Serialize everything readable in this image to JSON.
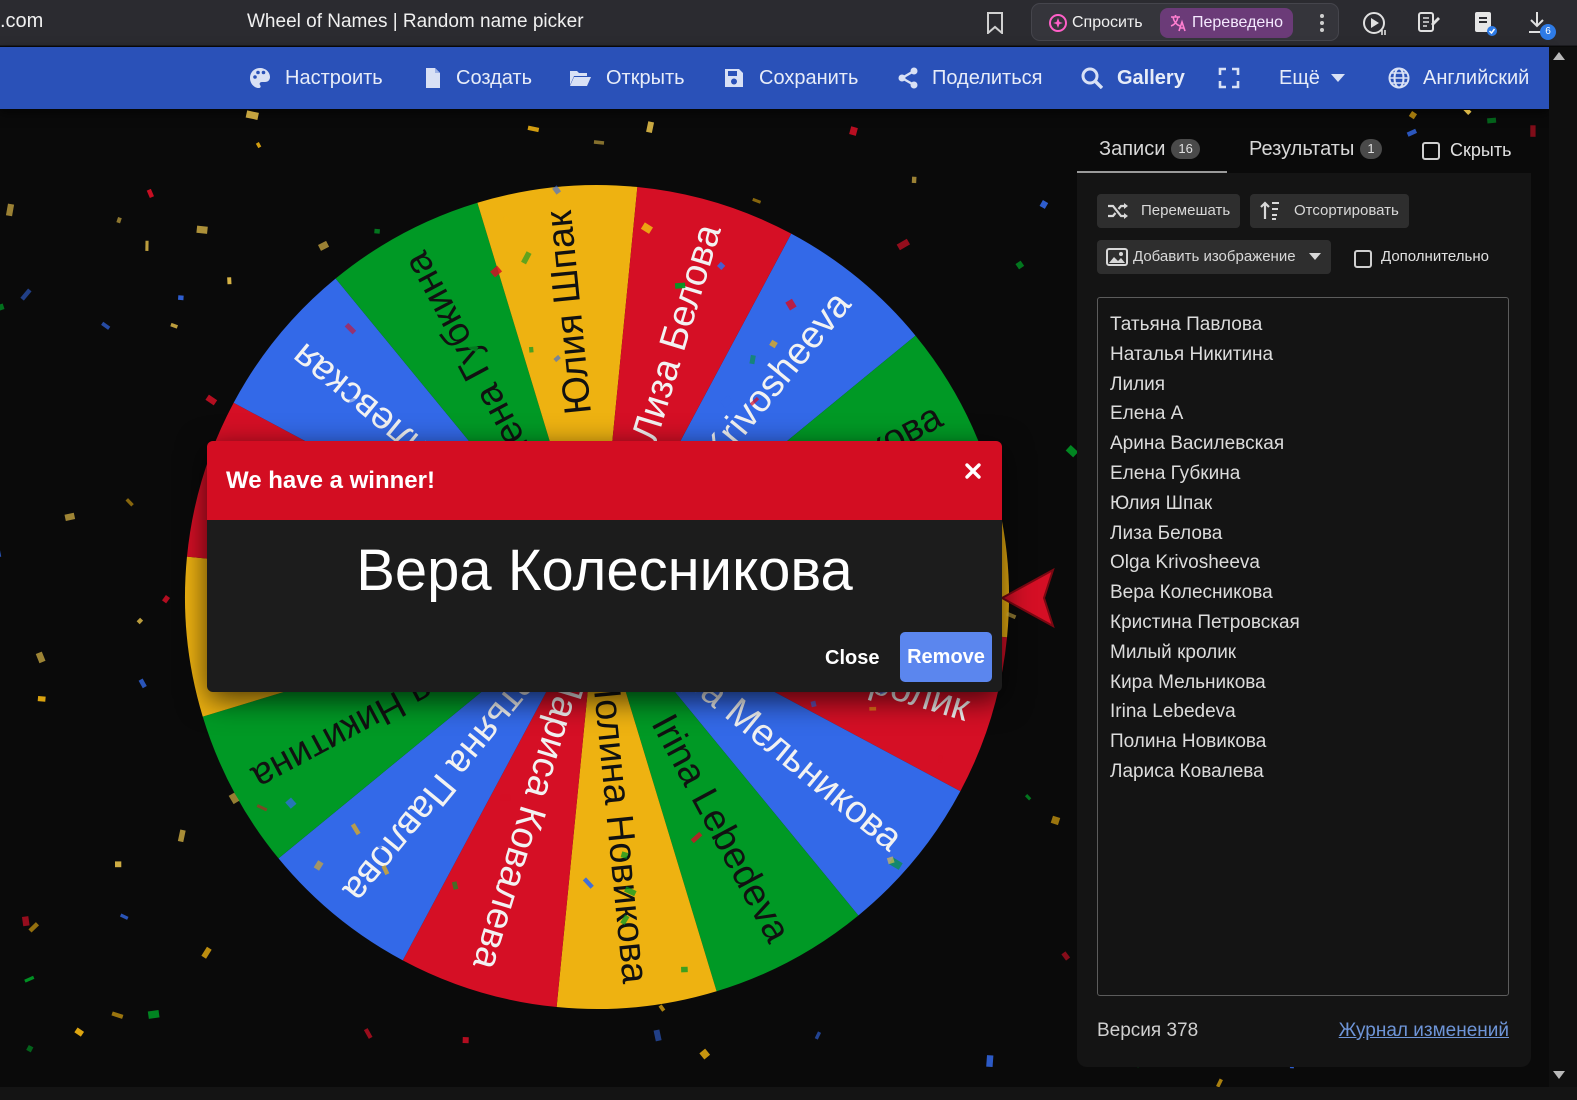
{
  "browser": {
    "url_fragment": ".com",
    "tab_title": "Wheel of Names | Random name picker",
    "ask_label": "Спросить",
    "translated_label": "Переведено",
    "downloads_count": "6"
  },
  "nav": {
    "customize": "Настроить",
    "new": "Создать",
    "open": "Открыть",
    "save": "Сохранить",
    "share": "Поделиться",
    "gallery": "Gallery",
    "more": "Ещё",
    "language": "Английский"
  },
  "wheel": {
    "colors": [
      "#3369e8",
      "#009925",
      "#eeb211",
      "#d50f25"
    ],
    "segments": [
      "Olga Krivosheeva",
      "Вера Колесникова",
      "Кристина Петровская",
      "Милый кролик",
      "Кира Мельникова",
      "Irina Lebedeva",
      "Полина Новикова",
      "Лариса Ковалева",
      "Татьяна Павлова",
      "Наталья Никитина",
      "Лилия",
      "Елена А",
      "Арина Василевская",
      "Елена Губкина",
      "Юлия Шпак",
      "Лиза Белова"
    ],
    "pointer_color": "#d50f25"
  },
  "modal": {
    "title": "We have a winner!",
    "winner": "Вера Колесникова",
    "close_label": "Close",
    "remove_label": "Remove"
  },
  "panel": {
    "tab_entries": "Записи",
    "entries_count": "16",
    "tab_results": "Результаты",
    "results_count": "1",
    "hide_label": "Скрыть",
    "shuffle_label": "Перемешать",
    "sort_label": "Отсортировать",
    "add_image_label": "Добавить изображение",
    "advanced_label": "Дополнительно",
    "entries": [
      "Татьяна Павлова",
      "Наталья Никитина",
      "Лилия",
      "Елена А",
      "Арина Василевская",
      "Елена Губкина",
      "Юлия Шпак",
      "Лиза Белова",
      "Olga Krivosheeva",
      "Вера Колесникова",
      "Кристина Петровская",
      "Милый кролик",
      "Кира Мельникова",
      "Irina Lebedeva",
      "Полина Новикова",
      "Лариса Ковалева"
    ],
    "version_label": "Версия 378",
    "changelog_label": "Журнал изменений"
  }
}
